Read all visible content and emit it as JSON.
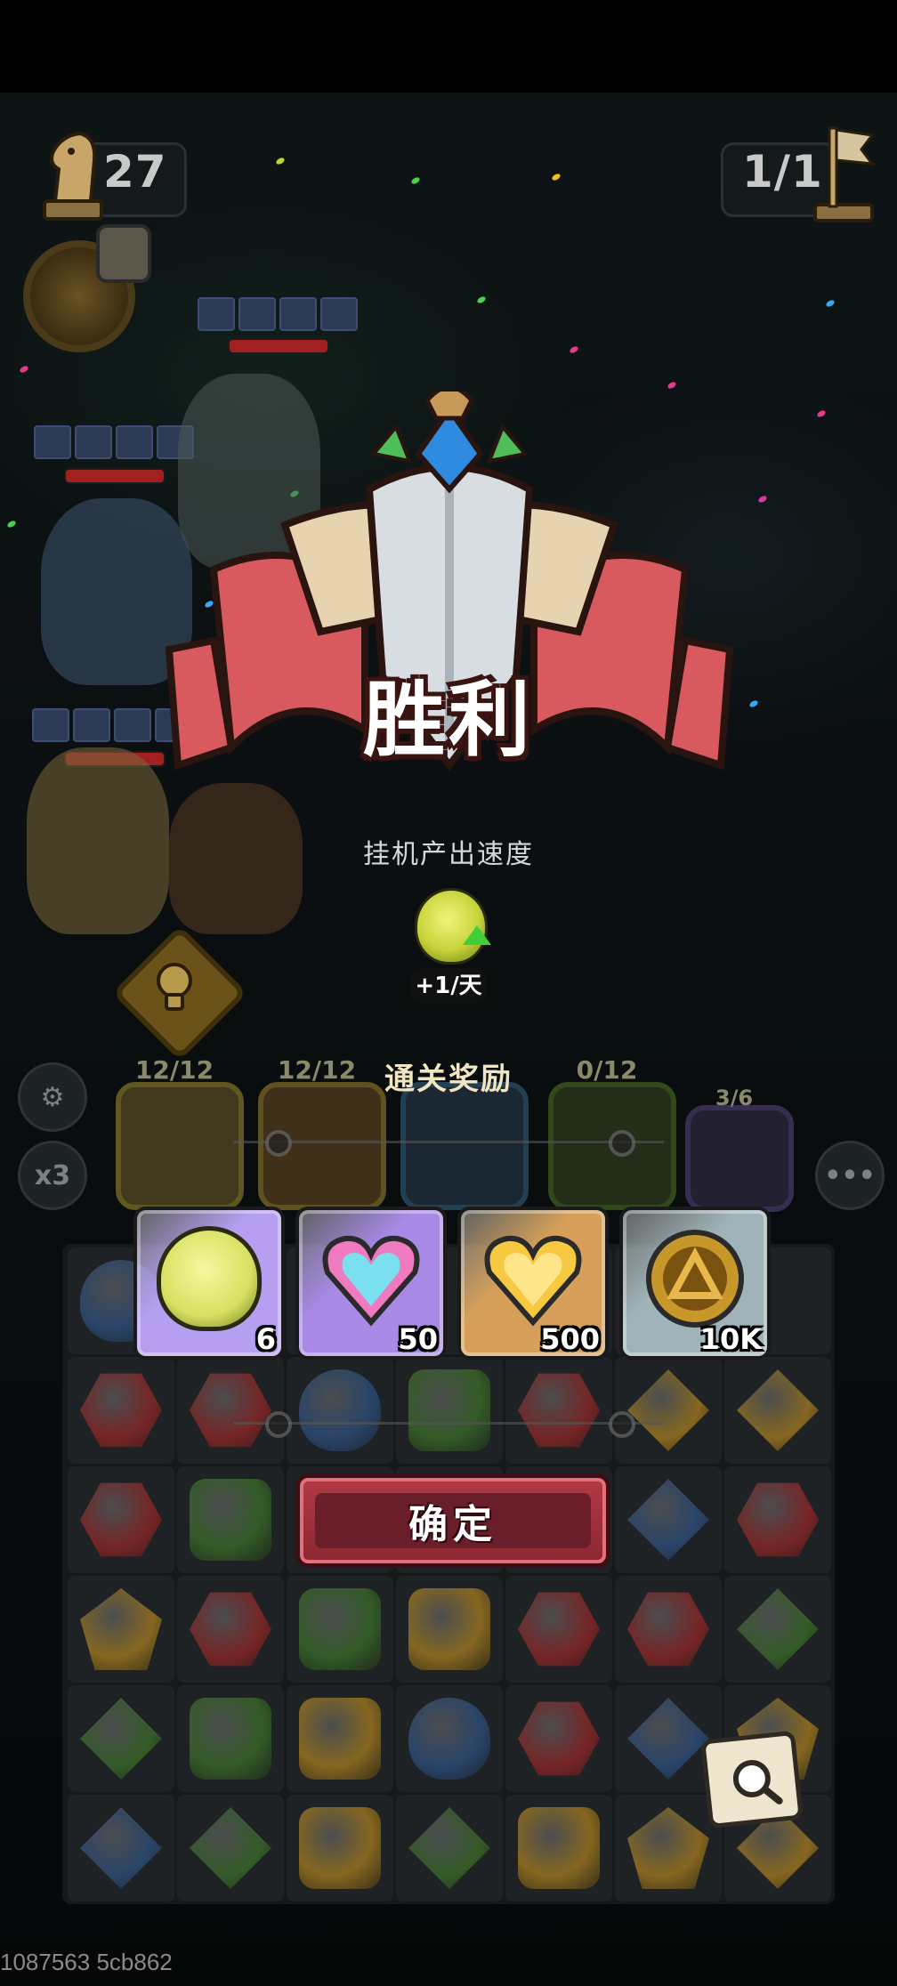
{
  "hud": {
    "moves": "27",
    "wave": "1/1"
  },
  "result": {
    "title": "胜利",
    "subtitle": "挂机产出速度",
    "rate_bonus": "+1/天"
  },
  "heroes": [
    {
      "count": "12/12",
      "color": "#e1c24a"
    },
    {
      "count": "12/12",
      "color": "#e1a53a"
    },
    {
      "count": "",
      "color": "#3b87b3"
    },
    {
      "count": "0/12",
      "color": "#5e9a2e"
    },
    {
      "count": "3/6",
      "color": "#7f66b3"
    }
  ],
  "rewards_title": "通关奖励",
  "rewards": [
    {
      "name": "spiral-essence",
      "count": "6",
      "bg": "#b69ef0",
      "glyph": "#d7e060"
    },
    {
      "name": "rainbow-heart",
      "count": "50",
      "bg": "#a889e6",
      "glyph": "#f07ac0"
    },
    {
      "name": "gold-heart",
      "count": "500",
      "bg": "#d6a05a",
      "glyph": "#f6c940"
    },
    {
      "name": "gold-coin",
      "count": "10K",
      "bg": "#9fb3b8",
      "glyph": "#c8972a"
    }
  ],
  "side_buttons": {
    "speed_label": "x3"
  },
  "confirm_label": "确定",
  "footer": "1087563 5cb862",
  "colors": {
    "red_gem": "#8f2626",
    "blue_gem": "#2d4e7c",
    "green_gem": "#3a6b28",
    "yellow_gem": "#a37a1f"
  }
}
